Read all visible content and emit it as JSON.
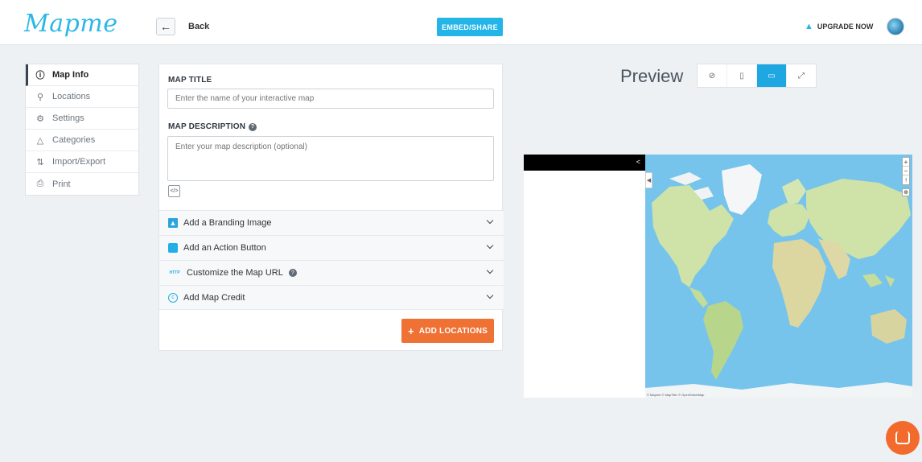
{
  "header": {
    "logo": "Mapme",
    "back_label": "Back",
    "embed_label": "EMBED/SHARE",
    "upgrade_label": "UPGRADE NOW",
    "icons": {
      "back": "arrow-left-icon",
      "trophy": "trophy-icon",
      "avatar": "globe-avatar-icon"
    }
  },
  "sidebar": {
    "items": [
      {
        "label": "Map Info",
        "icon": "info-icon",
        "active": true
      },
      {
        "label": "Locations",
        "icon": "pin-icon",
        "active": false
      },
      {
        "label": "Settings",
        "icon": "gear-icon",
        "active": false
      },
      {
        "label": "Categories",
        "icon": "shapes-icon",
        "active": false
      },
      {
        "label": "Import/Export",
        "icon": "import-export-icon",
        "active": false
      },
      {
        "label": "Print",
        "icon": "print-icon",
        "active": false
      }
    ]
  },
  "form": {
    "title_label": "MAP TITLE",
    "title_placeholder": "Enter the name of your interactive map",
    "title_value": "",
    "description_label": "MAP DESCRIPTION",
    "description_placeholder": "Enter your map description (optional)",
    "description_value": "",
    "accordion": [
      {
        "label": "Add a Branding Image",
        "icon": "image-icon"
      },
      {
        "label": "Add an Action Button",
        "icon": "square-icon"
      },
      {
        "label": "Customize the Map URL",
        "icon": "http-icon"
      },
      {
        "label": "Add Map Credit",
        "icon": "copyright-icon"
      }
    ],
    "add_locations_label": "ADD LOCATIONS"
  },
  "preview": {
    "label": "Preview",
    "view_modes": [
      {
        "name": "hide",
        "icon": "eye-off-icon",
        "active": false
      },
      {
        "name": "mobile",
        "icon": "mobile-icon",
        "active": false
      },
      {
        "name": "desktop",
        "icon": "desktop-icon",
        "active": true
      },
      {
        "name": "fullscreen",
        "icon": "expand-icon",
        "active": false
      }
    ],
    "map_attribution": "© Mapme © MapTiler © OpenStreetMap"
  },
  "colors": {
    "brand": "#2bb8e6",
    "accent": "#23b5e8",
    "cta": "#ef7134",
    "ocean": "#76c4ec",
    "land": "#c9dfa4"
  }
}
